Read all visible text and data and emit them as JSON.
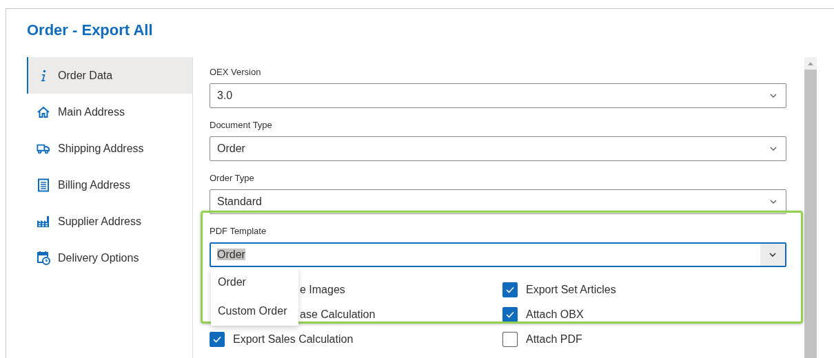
{
  "title": "Order - Export All",
  "sidebar": {
    "items": [
      {
        "label": "Order Data",
        "selected": true
      },
      {
        "label": "Main Address",
        "selected": false
      },
      {
        "label": "Shipping Address",
        "selected": false
      },
      {
        "label": "Billing Address",
        "selected": false
      },
      {
        "label": "Supplier Address",
        "selected": false
      },
      {
        "label": "Delivery Options",
        "selected": false
      }
    ]
  },
  "fields": [
    {
      "label": "OEX Version",
      "value": "3.0",
      "focused": false
    },
    {
      "label": "Document Type",
      "value": "Order",
      "focused": false
    },
    {
      "label": "Order Type",
      "value": "Standard",
      "focused": false
    },
    {
      "label": "PDF Template",
      "value": "Order",
      "focused": true,
      "open": true,
      "options": [
        {
          "label": "Order"
        },
        {
          "label": "Custom Order"
        }
      ]
    }
  ],
  "options": [
    {
      "kind": "covered",
      "label": "e Images"
    },
    {
      "kind": "checkbox",
      "label": "Export Set Articles",
      "checked": true
    },
    {
      "kind": "covered",
      "label": "ase Calculation"
    },
    {
      "kind": "checkbox",
      "label": "Attach OBX",
      "checked": true
    },
    {
      "kind": "checkbox",
      "label": "Export Sales Calculation",
      "checked": true
    },
    {
      "kind": "checkbox",
      "label": "Attach PDF",
      "checked": false
    }
  ]
}
